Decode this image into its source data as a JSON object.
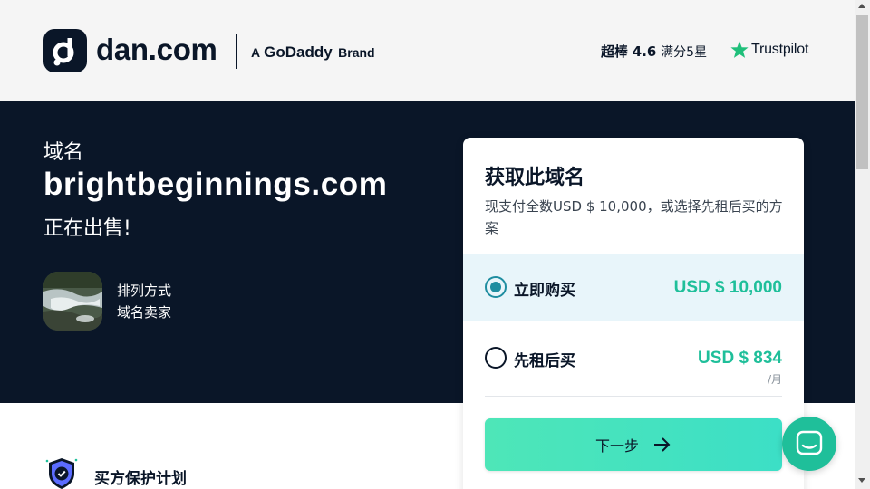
{
  "header": {
    "logo_text": "dan.com",
    "brand_prefix": "A",
    "brand_name": "GoDaddy",
    "brand_suffix": "Brand",
    "rating_label": "超棒",
    "rating_score": "4.6",
    "rating_suffix": "满分5星",
    "trustpilot_label": "Trustpilot"
  },
  "hero": {
    "eyebrow": "域名",
    "domain": "brightbeginnings.com",
    "status": "正在出售!",
    "seller_line1": "排列方式",
    "seller_line2": "域名卖家"
  },
  "protection": {
    "label": "买方保护计划"
  },
  "card": {
    "title": "获取此域名",
    "description": "现支付全数USD $ 10,000，或选择先租后买的方案",
    "options": [
      {
        "label": "立即购买",
        "price": "USD $ 10,000",
        "selected": true
      },
      {
        "label": "先租后买",
        "price": "USD $ 834",
        "unit": "/月",
        "selected": false
      }
    ],
    "next_label": "下一步"
  },
  "icons": {
    "logo": "dan-logo-icon",
    "star": "trustpilot-star-icon",
    "shield": "shield-check-icon",
    "arrow": "arrow-right-icon",
    "chat": "chat-icon"
  },
  "colors": {
    "navy": "#0a1628",
    "accent_green": "#1fbf9a",
    "selected_bg": "#e8f5fa",
    "radio_teal": "#1e8da0",
    "button_gradient_start": "#4ee6b8",
    "button_gradient_end": "#3cdfc6"
  }
}
